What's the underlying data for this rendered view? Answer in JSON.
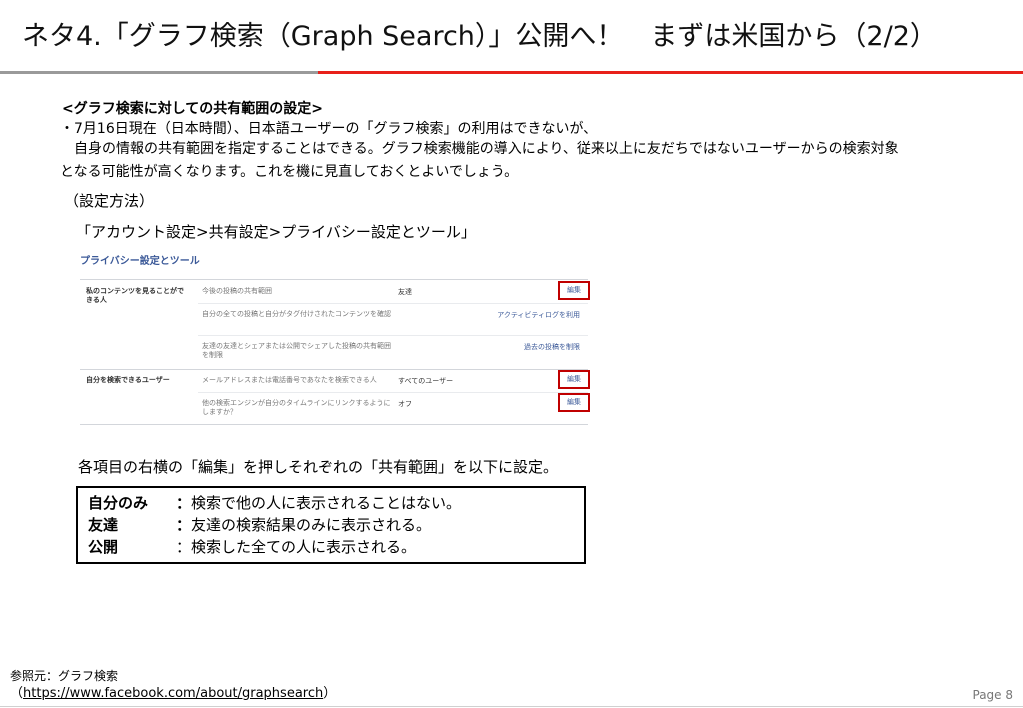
{
  "slide": {
    "title": "ネタ4.「グラフ検索（Graph Search）」公開へ！　まずは米国から（2/2）",
    "heading": "<グラフ検索に対しての共有範囲の設定>",
    "line1": "・7月16日現在（日本時間）、日本語ユーザーの「グラフ検索」の利用はできないが、",
    "line2": "　自身の情報の共有範囲を指定することはできる。グラフ検索機能の導入により、従来以上に友だちではないユーザーからの検索対象",
    "line3": "となる可能性が高くなります。これを機に見直しておくとよいでしょう。",
    "method": "（設定方法）",
    "path": "「アカウント設定>共有設定>プライバシー設定とツール」",
    "instruction": "各項目の右横の「編集」を押しそれぞれの「共有範囲」を以下に設定。",
    "colors": {
      "accent_red": "#e8201a",
      "rule_gray": "#9a9a9a",
      "link_blue": "#3b5998",
      "highlight": "#c00000"
    }
  },
  "privacy": {
    "title": "プライバシー設定とツール",
    "section1": "私のコンテンツを見ることがで\nきる人",
    "section2": "自分を検索できるユーザー",
    "rows": [
      {
        "q": "今後の投稿の共有範囲",
        "value": "友達",
        "action": "編集"
      },
      {
        "q": "自分の全ての投稿と自分がタグ付けされたコンテンツを確認",
        "value": "",
        "action": "アクティビティログを利用"
      },
      {
        "q": "友達の友達とシェアまたは公開でシェアした投稿の共有範囲を制限",
        "value": "",
        "action": "過去の投稿を制限"
      },
      {
        "q": "メールアドレスまたは電話番号であなたを検索できる人",
        "value": "すべてのユーザー",
        "action": "編集"
      },
      {
        "q": "他の検索エンジンが自分のタイムラインにリンクするようにしますか？",
        "value": "オフ",
        "action": "編集"
      }
    ]
  },
  "settings": [
    {
      "label": "自分のみ",
      "colon": "：",
      "desc": "検索で他の人に表示されることはない。"
    },
    {
      "label": "友達",
      "colon": "：",
      "desc": "友達の検索結果のみに表示される。"
    },
    {
      "label": "公開",
      "colon": "：",
      "desc": "検索した全ての人に表示される。"
    }
  ],
  "footer": {
    "source_label": "参照元：グラフ検索",
    "url_prefix": "（",
    "url": "https://www.facebook.com/about/graphsearch",
    "url_suffix": "）",
    "page": "Page 8"
  }
}
